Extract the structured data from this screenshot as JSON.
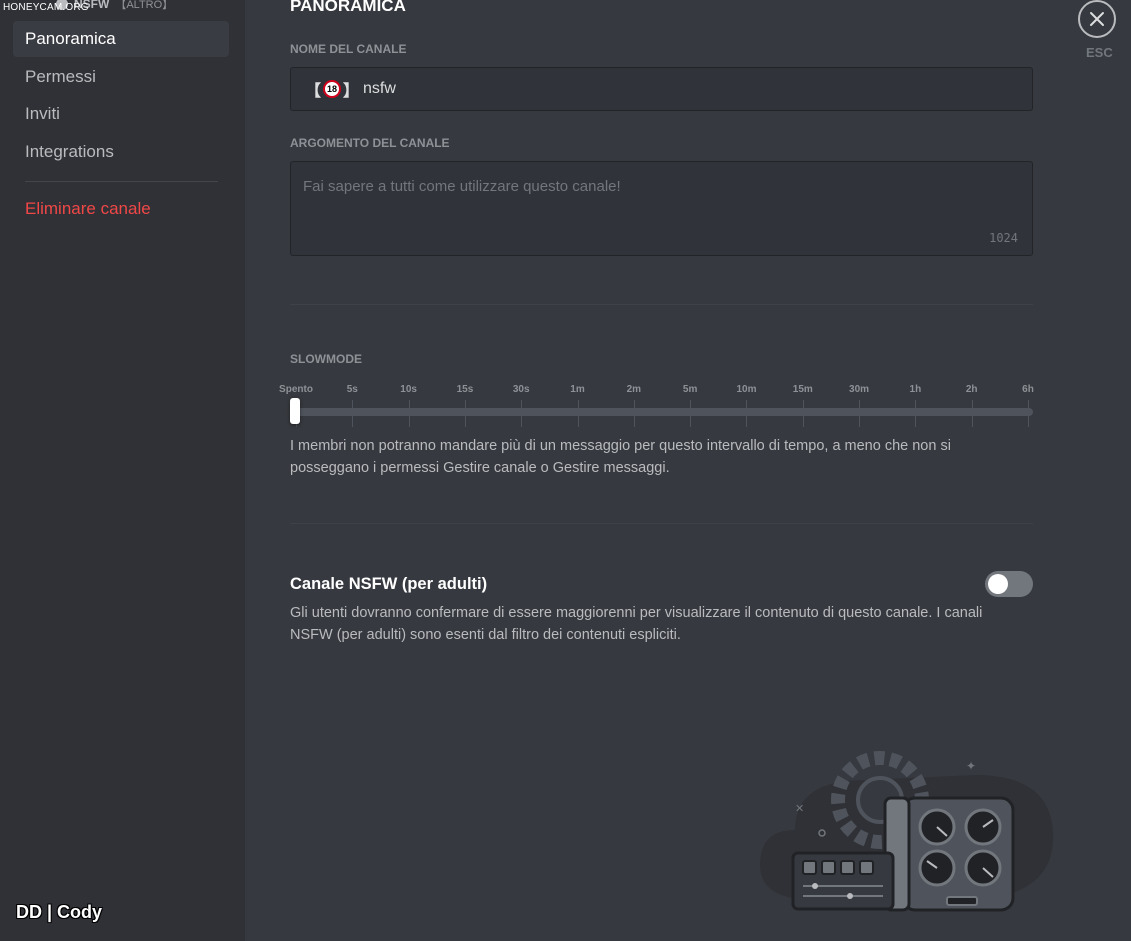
{
  "watermark": "HONEYCAM.ORG",
  "sidebar": {
    "header": {
      "channel": "NSFW",
      "category": "【ALTRO】"
    },
    "items": [
      {
        "label": "Panoramica"
      },
      {
        "label": "Permessi"
      },
      {
        "label": "Inviti"
      },
      {
        "label": "Integrations"
      }
    ],
    "delete_label": "Eliminare canale",
    "footer_user": "DD | Cody"
  },
  "main": {
    "title": "PANORAMICA",
    "name_label": "NOME DEL CANALE",
    "name_value": {
      "open": "【",
      "badge": "18",
      "close": "】",
      "text": "nsfw"
    },
    "topic_label": "ARGOMENTO DEL CANALE",
    "topic_placeholder": "Fai sapere a tutti come utilizzare questo canale!",
    "topic_counter": "1024",
    "slowmode": {
      "label": "SLOWMODE",
      "stops": [
        "Spento",
        "5s",
        "10s",
        "15s",
        "30s",
        "1m",
        "2m",
        "5m",
        "10m",
        "15m",
        "30m",
        "1h",
        "2h",
        "6h"
      ],
      "selected": "Spento",
      "description": "I membri non potranno mandare più di un messaggio per questo intervallo di tempo, a meno che non si posseggano i permessi Gestire canale o Gestire messaggi."
    },
    "nsfw": {
      "title": "Canale NSFW (per adulti)",
      "enabled": false,
      "description": "Gli utenti dovranno confermare di essere maggiorenni per visualizzare il contenuto di questo canale. I canali NSFW (per adulti) sono esenti dal filtro dei contenuti espliciti."
    },
    "close_label": "ESC"
  },
  "colors": {
    "background": "#36393f",
    "sidebar": "#2f3136",
    "danger": "#f04747",
    "toggle_off": "#72767d"
  }
}
